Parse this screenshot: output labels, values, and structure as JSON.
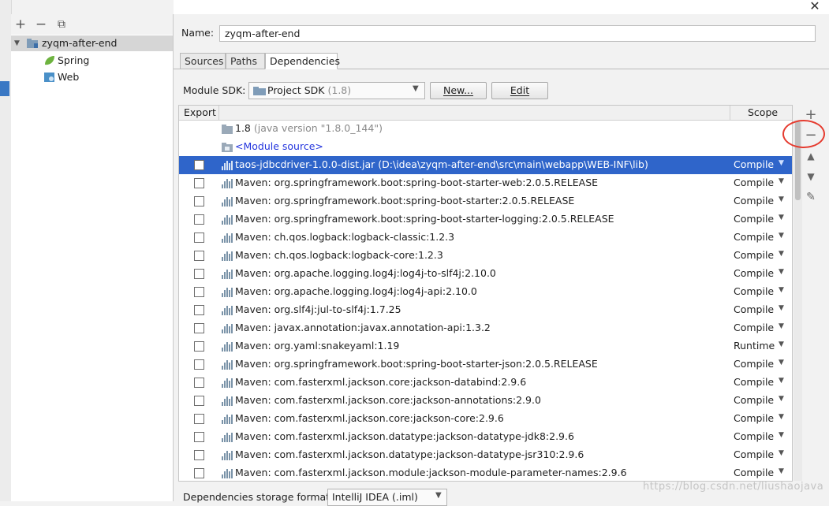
{
  "tree": {
    "toolbar": [
      "+",
      "−",
      "⧉"
    ],
    "root": "zyqm-after-end",
    "children": [
      {
        "label": "Spring",
        "icon": "spring-leaf-icon",
        "color": "#6db33f"
      },
      {
        "label": "Web",
        "icon": "web-facet-icon",
        "color": "#4a90c8"
      }
    ]
  },
  "form": {
    "name_label": "Name:",
    "name_value": "zyqm-after-end"
  },
  "tabs": [
    "Sources",
    "Paths",
    "Dependencies"
  ],
  "active_tab": "Dependencies",
  "sdk": {
    "label": "Module SDK:",
    "value": "Project SDK",
    "version": "(1.8)",
    "new_label": "New...",
    "edit_label": "Edit"
  },
  "table": {
    "headers": {
      "export": "Export",
      "scope": "Scope"
    },
    "sdk_row": {
      "name": "1.8",
      "detail": "(java version \"1.8.0_144\")"
    },
    "module_source": "<Module source>",
    "rows": [
      {
        "name": "taos-jdbcdriver-1.0.0-dist.jar (D:\\idea\\zyqm-after-end\\src\\main\\webapp\\WEB-INF\\lib)",
        "scope": "Compile",
        "selected": true
      },
      {
        "name": "Maven: org.springframework.boot:spring-boot-starter-web:2.0.5.RELEASE",
        "scope": "Compile"
      },
      {
        "name": "Maven: org.springframework.boot:spring-boot-starter:2.0.5.RELEASE",
        "scope": "Compile"
      },
      {
        "name": "Maven: org.springframework.boot:spring-boot-starter-logging:2.0.5.RELEASE",
        "scope": "Compile"
      },
      {
        "name": "Maven: ch.qos.logback:logback-classic:1.2.3",
        "scope": "Compile"
      },
      {
        "name": "Maven: ch.qos.logback:logback-core:1.2.3",
        "scope": "Compile"
      },
      {
        "name": "Maven: org.apache.logging.log4j:log4j-to-slf4j:2.10.0",
        "scope": "Compile"
      },
      {
        "name": "Maven: org.apache.logging.log4j:log4j-api:2.10.0",
        "scope": "Compile"
      },
      {
        "name": "Maven: org.slf4j:jul-to-slf4j:1.7.25",
        "scope": "Compile"
      },
      {
        "name": "Maven: javax.annotation:javax.annotation-api:1.3.2",
        "scope": "Compile"
      },
      {
        "name": "Maven: org.yaml:snakeyaml:1.19",
        "scope": "Runtime"
      },
      {
        "name": "Maven: org.springframework.boot:spring-boot-starter-json:2.0.5.RELEASE",
        "scope": "Compile"
      },
      {
        "name": "Maven: com.fasterxml.jackson.core:jackson-databind:2.9.6",
        "scope": "Compile"
      },
      {
        "name": "Maven: com.fasterxml.jackson.core:jackson-annotations:2.9.0",
        "scope": "Compile"
      },
      {
        "name": "Maven: com.fasterxml.jackson.core:jackson-core:2.9.6",
        "scope": "Compile"
      },
      {
        "name": "Maven: com.fasterxml.jackson.datatype:jackson-datatype-jdk8:2.9.6",
        "scope": "Compile"
      },
      {
        "name": "Maven: com.fasterxml.jackson.datatype:jackson-datatype-jsr310:2.9.6",
        "scope": "Compile"
      },
      {
        "name": "Maven: com.fasterxml.jackson.module:jackson-module-parameter-names:2.9.6",
        "scope": "Compile"
      }
    ]
  },
  "side_toolbar": [
    "+",
    "−",
    "▲",
    "▼",
    "✎"
  ],
  "storage": {
    "label": "Dependencies storage format:",
    "value": "IntelliJ IDEA (.iml)"
  },
  "watermark": "https://blog.csdn.net/liushaojava",
  "colors": {
    "selection": "#2f65ca",
    "highlight_circle": "#e53b2f",
    "link": "#2233dd"
  }
}
